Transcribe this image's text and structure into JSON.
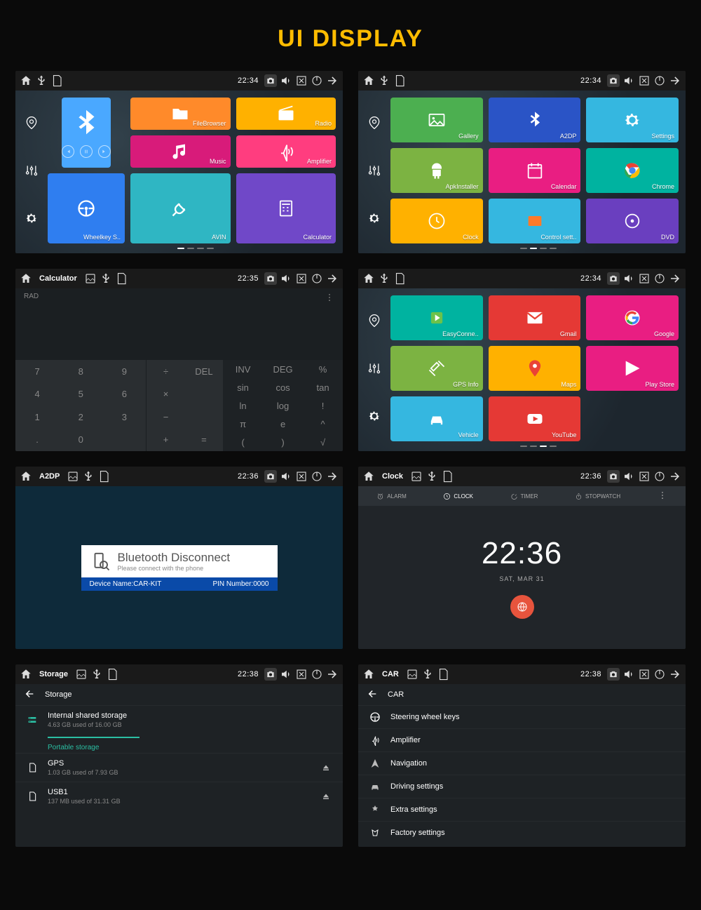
{
  "page_title": "UI DISPLAY",
  "colors": {
    "orange": "#ff8a2a",
    "amber": "#ffb100",
    "magenta": "#d81b7a",
    "pink": "#ff3d7f",
    "blue": "#2f7ef0",
    "cyan": "#2fb6c3",
    "violet": "#7048c8",
    "teal": "#00b3a0",
    "green": "#4caf50",
    "deepblue": "#2a54c6",
    "hotpink": "#e91e82",
    "lime": "#7cb342",
    "skyblue": "#35b7e0",
    "purple": "#6a3fbf",
    "red": "#e53935",
    "bigblue": "#4aa8ff"
  },
  "status": {
    "time_home": "22:34",
    "time_calc": "22:35",
    "time_a2dp": "22:36",
    "time_clock": "22:36",
    "time_storage": "22:38",
    "time_car": "22:38"
  },
  "panel1": {
    "big_label": "",
    "row1": [
      {
        "label": "FileBrowser",
        "c": "orange",
        "icon": "folder"
      },
      {
        "label": "Radio",
        "c": "amber",
        "icon": "radio"
      }
    ],
    "row2": [
      {
        "label": "Music",
        "c": "magenta",
        "icon": "music"
      },
      {
        "label": "Amplifier",
        "c": "pink",
        "icon": "amp"
      }
    ],
    "row3": [
      {
        "label": "Wheelkey S..",
        "c": "blue",
        "icon": "wheel"
      },
      {
        "label": "AVIN",
        "c": "cyan",
        "icon": "plug"
      },
      {
        "label": "Calculator",
        "c": "violet",
        "icon": "calc"
      }
    ]
  },
  "panel2": {
    "tiles": [
      [
        {
          "label": "Gallery",
          "c": "green",
          "icon": "image"
        },
        {
          "label": "A2DP",
          "c": "deepblue",
          "icon": "bt"
        },
        {
          "label": "Settings",
          "c": "skyblue",
          "icon": "gear"
        }
      ],
      [
        {
          "label": "ApkInstaller",
          "c": "lime",
          "icon": "android"
        },
        {
          "label": "Calendar",
          "c": "hotpink",
          "icon": "calendar"
        },
        {
          "label": "Chrome",
          "c": "teal",
          "icon": "chrome"
        }
      ],
      [
        {
          "label": "Clock",
          "c": "amber",
          "icon": "clock"
        },
        {
          "label": "Control sett..",
          "c": "skyblue",
          "icon": "control"
        },
        {
          "label": "DVD",
          "c": "purple",
          "icon": "dvd"
        }
      ]
    ]
  },
  "calc": {
    "title": "Calculator",
    "mode": "RAD",
    "nums": [
      "7",
      "8",
      "9",
      "4",
      "5",
      "6",
      "1",
      "2",
      "3",
      ".",
      "0",
      ""
    ],
    "ops": [
      "÷",
      "DEL",
      "×",
      "",
      "−",
      "",
      "+",
      "="
    ],
    "fns": [
      "INV",
      "DEG",
      "%",
      "sin",
      "cos",
      "tan",
      "ln",
      "log",
      "!",
      "π",
      "e",
      "^",
      "(",
      ")",
      "√"
    ]
  },
  "panel4": {
    "tiles": [
      [
        {
          "label": "EasyConne..",
          "c": "teal",
          "icon": "easy"
        },
        {
          "label": "Gmail",
          "c": "red",
          "icon": "gmail"
        },
        {
          "label": "Google",
          "c": "hotpink",
          "icon": "google"
        }
      ],
      [
        {
          "label": "GPS Info",
          "c": "lime",
          "icon": "sat"
        },
        {
          "label": "Maps",
          "c": "amber",
          "icon": "maps"
        },
        {
          "label": "Play Store",
          "c": "hotpink",
          "icon": "play"
        }
      ],
      [
        {
          "label": "Vehicle",
          "c": "skyblue",
          "icon": "car"
        },
        {
          "label": "YouTube",
          "c": "red",
          "icon": "yt"
        }
      ]
    ]
  },
  "a2dp": {
    "title": "A2DP",
    "heading": "Bluetooth Disconnect",
    "sub": "Please connect with the phone",
    "device_label": "Device Name:CAR-KIT",
    "pin_label": "PIN Number:0000"
  },
  "clock": {
    "title": "Clock",
    "tabs": [
      "ALARM",
      "CLOCK",
      "TIMER",
      "STOPWATCH"
    ],
    "time": "22:36",
    "date": "SAT, MAR 31"
  },
  "storage": {
    "title": "Storage",
    "header": "Storage",
    "internal_title": "Internal shared storage",
    "internal_sub": "4.63 GB used of 16.00 GB",
    "portable": "Portable storage",
    "gps_title": "GPS",
    "gps_sub": "1.03 GB used of 7.93 GB",
    "usb_title": "USB1",
    "usb_sub": "137 MB used of 31.31 GB"
  },
  "car": {
    "title": "CAR",
    "header": "CAR",
    "items": [
      "Steering wheel keys",
      "Amplifier",
      "Navigation",
      "Driving settings",
      "Extra settings",
      "Factory settings"
    ]
  }
}
